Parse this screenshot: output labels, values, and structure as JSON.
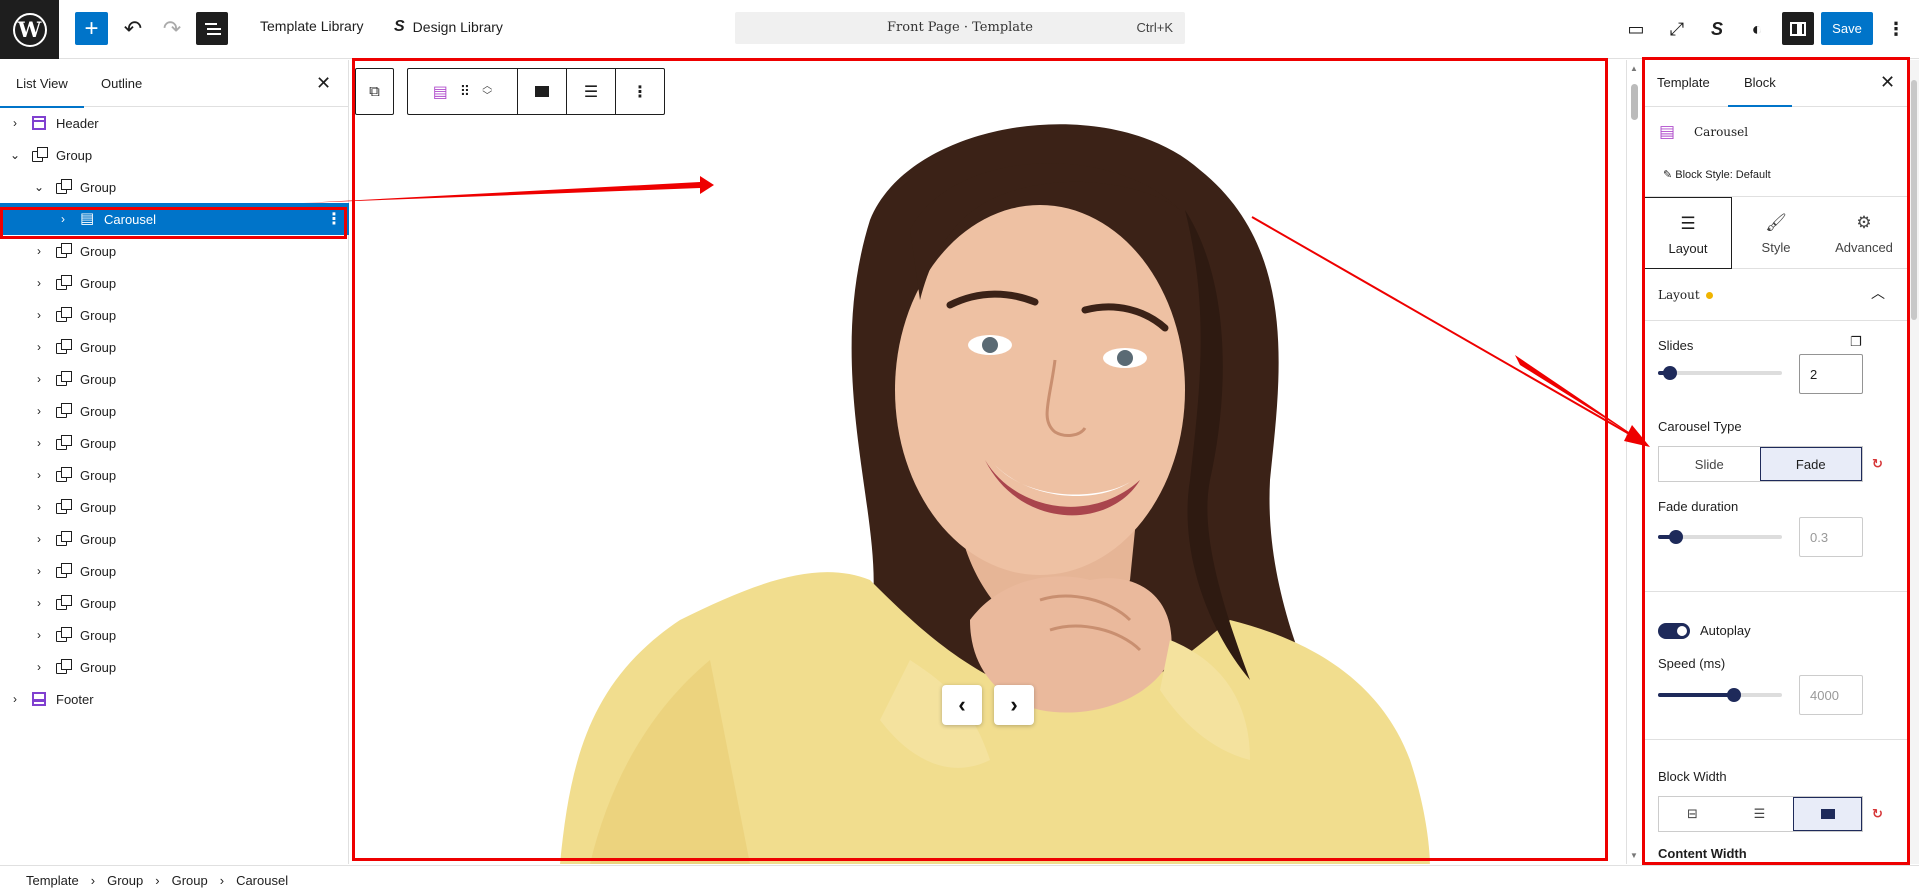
{
  "topbar": {
    "template_library": "Template Library",
    "design_library": "Design Library",
    "command_title": "Front Page · Template",
    "command_shortcut": "Ctrl+K",
    "save_label": "Save"
  },
  "listview": {
    "tabs": [
      "List View",
      "Outline"
    ],
    "active_tab": "List View",
    "items": [
      {
        "label": "Header",
        "icon": "template-part-header-icon",
        "depth": 0,
        "expanded": false
      },
      {
        "label": "Group",
        "icon": "group-icon",
        "depth": 0,
        "expanded": true
      },
      {
        "label": "Group",
        "icon": "group-icon",
        "depth": 1,
        "expanded": true
      },
      {
        "label": "Carousel",
        "icon": "carousel-icon",
        "depth": 2,
        "expanded": false,
        "selected": true
      },
      {
        "label": "Group",
        "icon": "group-icon",
        "depth": 1,
        "expanded": false
      },
      {
        "label": "Group",
        "icon": "group-icon",
        "depth": 1,
        "expanded": false
      },
      {
        "label": "Group",
        "icon": "group-icon",
        "depth": 1,
        "expanded": false
      },
      {
        "label": "Group",
        "icon": "group-icon",
        "depth": 1,
        "expanded": false
      },
      {
        "label": "Group",
        "icon": "group-icon",
        "depth": 1,
        "expanded": false
      },
      {
        "label": "Group",
        "icon": "group-icon",
        "depth": 1,
        "expanded": false
      },
      {
        "label": "Group",
        "icon": "group-icon",
        "depth": 1,
        "expanded": false
      },
      {
        "label": "Group",
        "icon": "group-icon",
        "depth": 1,
        "expanded": false
      },
      {
        "label": "Group",
        "icon": "group-icon",
        "depth": 1,
        "expanded": false
      },
      {
        "label": "Group",
        "icon": "group-icon",
        "depth": 1,
        "expanded": false
      },
      {
        "label": "Group",
        "icon": "group-icon",
        "depth": 1,
        "expanded": false
      },
      {
        "label": "Group",
        "icon": "group-icon",
        "depth": 1,
        "expanded": false
      },
      {
        "label": "Group",
        "icon": "group-icon",
        "depth": 1,
        "expanded": false
      },
      {
        "label": "Group",
        "icon": "group-icon",
        "depth": 1,
        "expanded": false
      },
      {
        "label": "Footer",
        "icon": "template-part-footer-icon",
        "depth": 0,
        "expanded": false
      }
    ]
  },
  "sidebar": {
    "tabs": [
      "Template",
      "Block"
    ],
    "active_tab": "Block",
    "block_name": "Carousel",
    "block_style": "Block Style: Default",
    "modes": [
      "Layout",
      "Style",
      "Advanced"
    ],
    "active_mode": "Layout",
    "section_title": "Layout",
    "slides_label": "Slides",
    "slides_value": "2",
    "carousel_type_label": "Carousel Type",
    "carousel_type_options": [
      "Slide",
      "Fade"
    ],
    "carousel_type_selected": "Fade",
    "fade_duration_label": "Fade duration",
    "fade_duration_placeholder": "0.3",
    "autoplay_label": "Autoplay",
    "autoplay_on": true,
    "speed_label": "Speed (ms)",
    "speed_placeholder": "4000",
    "block_width_label": "Block Width",
    "block_width_selected": "full",
    "content_width_label": "Content Width"
  },
  "breadcrumb": [
    "Template",
    "Group",
    "Group",
    "Carousel"
  ],
  "colors": {
    "accent": "#0074c9",
    "highlight": "#e00000",
    "dark": "#1e1e1e",
    "control": "#1e2a5a"
  }
}
